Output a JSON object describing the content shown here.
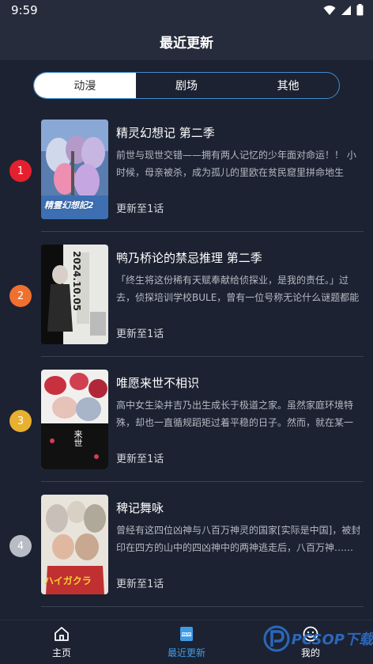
{
  "status": {
    "time": "9:59"
  },
  "header": {
    "title": "最近更新"
  },
  "tabs": [
    {
      "label": "动漫",
      "active": true
    },
    {
      "label": "剧场",
      "active": false
    },
    {
      "label": "其他",
      "active": false
    }
  ],
  "items": [
    {
      "rank": "1",
      "rank_color": "#e5202e",
      "title": "精灵幻想记 第二季",
      "description": "前世与现世交错——拥有两人记忆的少年面对命运！！ 小时候，母亲被杀，成为孤儿的里欧在贫民窟里拼命地生活……",
      "update": "更新至1话",
      "cover_text": "精霊幻想記2"
    },
    {
      "rank": "2",
      "rank_color": "#f07030",
      "title": "鸭乃桥论的禁忌推理 第二季",
      "description": "「终生将这份稀有天赋奉献给侦探业，是我的责任。」过去，侦探培训学校BULE，曾有一位号称无论什么谜题都能解开……",
      "update": "更新至1话",
      "cover_text": "2024.10.05"
    },
    {
      "rank": "3",
      "rank_color": "#e8b030",
      "title": "唯愿来世不相识",
      "description": "高中女生染井吉乃出生成长于极道之家。虽然家庭环境特殊，却也一直循规蹈矩过着平稳的日子。然而，就在某一天……",
      "update": "更新至1话",
      "cover_text": "来世"
    },
    {
      "rank": "4",
      "rank_color": "#b8bcc4",
      "title": "稗记舞咏",
      "description": "曾经有这四位凶神与八百万神灵的国家[实际是中国]，被封印在四方的山中的四凶神中的两神逃走后，八百万神……",
      "update": "更新至1话",
      "cover_text": "ハイガクラ"
    }
  ],
  "nav": [
    {
      "label": "主页",
      "icon": "home-icon",
      "active": false
    },
    {
      "label": "最近更新",
      "icon": "new-icon",
      "active": true
    },
    {
      "label": "我的",
      "icon": "smile-icon",
      "active": false
    }
  ],
  "watermark": {
    "text": "PCSOP下载"
  },
  "colors": {
    "accent": "#3f9be6",
    "background": "#1c2231",
    "header": "#262c3b"
  }
}
